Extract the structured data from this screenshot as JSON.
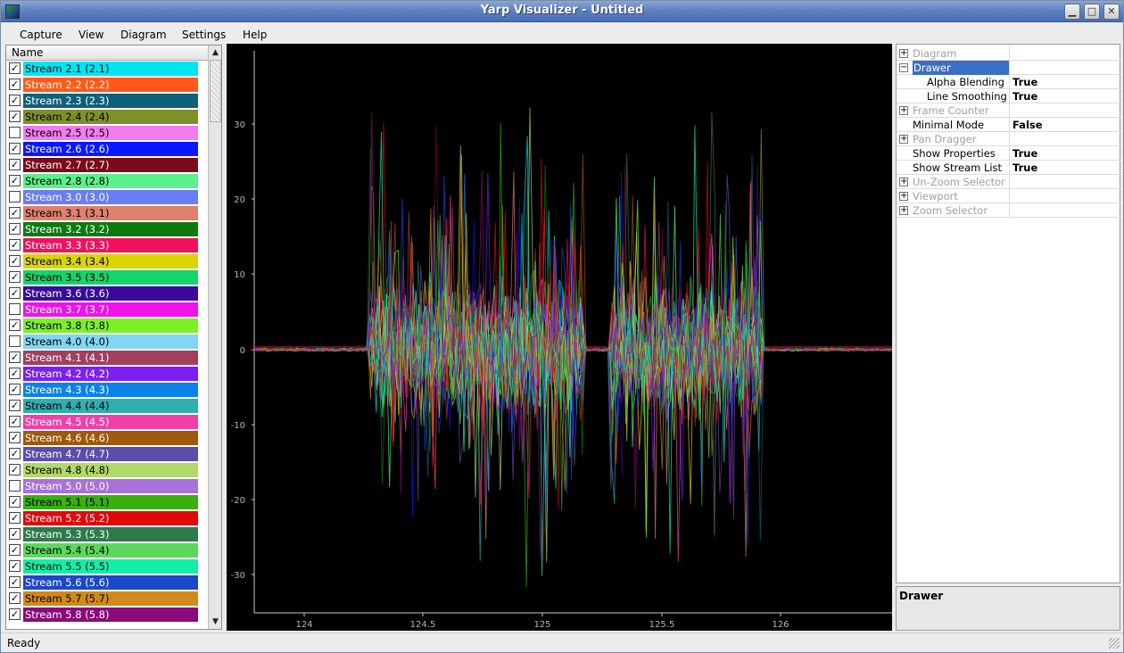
{
  "window": {
    "title": "Yarp Visualizer - Untitled"
  },
  "menu": [
    "Capture",
    "View",
    "Diagram",
    "Settings",
    "Help"
  ],
  "stream_list": {
    "header": "Name",
    "items": [
      {
        "label": "Stream 2.1 (2.1)",
        "checked": true,
        "color": "#00e5f4",
        "text": "#000"
      },
      {
        "label": "Stream 2.2 (2.2)",
        "checked": true,
        "color": "#ff5a1a",
        "text": "#fff"
      },
      {
        "label": "Stream 2.3 (2.3)",
        "checked": true,
        "color": "#11607a",
        "text": "#fff"
      },
      {
        "label": "Stream 2.4 (2.4)",
        "checked": true,
        "color": "#7f8f2a",
        "text": "#000"
      },
      {
        "label": "Stream 2.5 (2.5)",
        "checked": false,
        "color": "#f07cf0",
        "text": "#000"
      },
      {
        "label": "Stream 2.6 (2.6)",
        "checked": true,
        "color": "#0a18ff",
        "text": "#fff"
      },
      {
        "label": "Stream 2.7 (2.7)",
        "checked": true,
        "color": "#7a0a1c",
        "text": "#fff"
      },
      {
        "label": "Stream 2.8 (2.8)",
        "checked": true,
        "color": "#5cf08c",
        "text": "#000"
      },
      {
        "label": "Stream 3.0 (3.0)",
        "checked": false,
        "color": "#6a7ef2",
        "text": "#fff"
      },
      {
        "label": "Stream 3.1 (3.1)",
        "checked": true,
        "color": "#e0806e",
        "text": "#000"
      },
      {
        "label": "Stream 3.2 (3.2)",
        "checked": true,
        "color": "#0c7a10",
        "text": "#fff"
      },
      {
        "label": "Stream 3.3 (3.3)",
        "checked": true,
        "color": "#f0125e",
        "text": "#fff"
      },
      {
        "label": "Stream 3.4 (3.4)",
        "checked": true,
        "color": "#dcd400",
        "text": "#000"
      },
      {
        "label": "Stream 3.5 (3.5)",
        "checked": true,
        "color": "#14d46a",
        "text": "#000"
      },
      {
        "label": "Stream 3.6 (3.6)",
        "checked": true,
        "color": "#3a0a9a",
        "text": "#fff"
      },
      {
        "label": "Stream 3.7 (3.7)",
        "checked": false,
        "color": "#f012e8",
        "text": "#fff"
      },
      {
        "label": "Stream 3.8 (3.8)",
        "checked": true,
        "color": "#7cf026",
        "text": "#000"
      },
      {
        "label": "Stream 4.0 (4.0)",
        "checked": false,
        "color": "#80d6f4",
        "text": "#000"
      },
      {
        "label": "Stream 4.1 (4.1)",
        "checked": true,
        "color": "#a0405e",
        "text": "#fff"
      },
      {
        "label": "Stream 4.2 (4.2)",
        "checked": true,
        "color": "#7a20f4",
        "text": "#fff"
      },
      {
        "label": "Stream 4.3 (4.3)",
        "checked": true,
        "color": "#0a82e8",
        "text": "#fff"
      },
      {
        "label": "Stream 4.4 (4.4)",
        "checked": true,
        "color": "#30aeb0",
        "text": "#000"
      },
      {
        "label": "Stream 4.5 (4.5)",
        "checked": true,
        "color": "#f040a8",
        "text": "#fff"
      },
      {
        "label": "Stream 4.6 (4.6)",
        "checked": true,
        "color": "#a0580a",
        "text": "#fff"
      },
      {
        "label": "Stream 4.7 (4.7)",
        "checked": true,
        "color": "#5a4ea8",
        "text": "#fff"
      },
      {
        "label": "Stream 4.8 (4.8)",
        "checked": true,
        "color": "#b0d86a",
        "text": "#000"
      },
      {
        "label": "Stream 5.0 (5.0)",
        "checked": false,
        "color": "#a872d8",
        "text": "#fff"
      },
      {
        "label": "Stream 5.1 (5.1)",
        "checked": true,
        "color": "#38b010",
        "text": "#000"
      },
      {
        "label": "Stream 5.2 (5.2)",
        "checked": true,
        "color": "#e00a0a",
        "text": "#fff"
      },
      {
        "label": "Stream 5.3 (5.3)",
        "checked": true,
        "color": "#2e7a4a",
        "text": "#fff"
      },
      {
        "label": "Stream 5.4 (5.4)",
        "checked": true,
        "color": "#5cd85c",
        "text": "#000"
      },
      {
        "label": "Stream 5.5 (5.5)",
        "checked": true,
        "color": "#12f0a8",
        "text": "#000"
      },
      {
        "label": "Stream 5.6 (5.6)",
        "checked": true,
        "color": "#1a48c8",
        "text": "#fff"
      },
      {
        "label": "Stream 5.7 (5.7)",
        "checked": true,
        "color": "#d08a1a",
        "text": "#000"
      },
      {
        "label": "Stream 5.8 (5.8)",
        "checked": true,
        "color": "#8a0a7a",
        "text": "#fff"
      }
    ]
  },
  "plot": {
    "x_ticks": [
      "124",
      "124.5",
      "125",
      "125.5",
      "126"
    ],
    "y_ticks": [
      "30",
      "20",
      "10",
      "0",
      "-10",
      "-20",
      "-30"
    ]
  },
  "properties": {
    "items": [
      {
        "label": "Diagram",
        "value": "",
        "expander": "+",
        "disabled": true,
        "selected": false,
        "indent": false
      },
      {
        "label": "Drawer",
        "value": "",
        "expander": "−",
        "disabled": false,
        "selected": true,
        "indent": false
      },
      {
        "label": "Alpha Blending",
        "value": "True",
        "expander": "",
        "disabled": false,
        "selected": false,
        "indent": true
      },
      {
        "label": "Line Smoothing",
        "value": "True",
        "expander": "",
        "disabled": false,
        "selected": false,
        "indent": true
      },
      {
        "label": "Frame Counter",
        "value": "",
        "expander": "+",
        "disabled": true,
        "selected": false,
        "indent": false
      },
      {
        "label": "Minimal Mode",
        "value": "False",
        "expander": "",
        "disabled": false,
        "selected": false,
        "indent": false
      },
      {
        "label": "Pan Dragger",
        "value": "",
        "expander": "+",
        "disabled": true,
        "selected": false,
        "indent": false
      },
      {
        "label": "Show Properties",
        "value": "True",
        "expander": "",
        "disabled": false,
        "selected": false,
        "indent": false
      },
      {
        "label": "Show Stream List",
        "value": "True",
        "expander": "",
        "disabled": false,
        "selected": false,
        "indent": false
      },
      {
        "label": "Un-Zoom Selector",
        "value": "",
        "expander": "+",
        "disabled": true,
        "selected": false,
        "indent": false
      },
      {
        "label": "Viewport",
        "value": "",
        "expander": "+",
        "disabled": true,
        "selected": false,
        "indent": false
      },
      {
        "label": "Zoom Selector",
        "value": "",
        "expander": "+",
        "disabled": true,
        "selected": false,
        "indent": false
      }
    ],
    "description": "Drawer"
  },
  "status": {
    "text": "Ready"
  }
}
